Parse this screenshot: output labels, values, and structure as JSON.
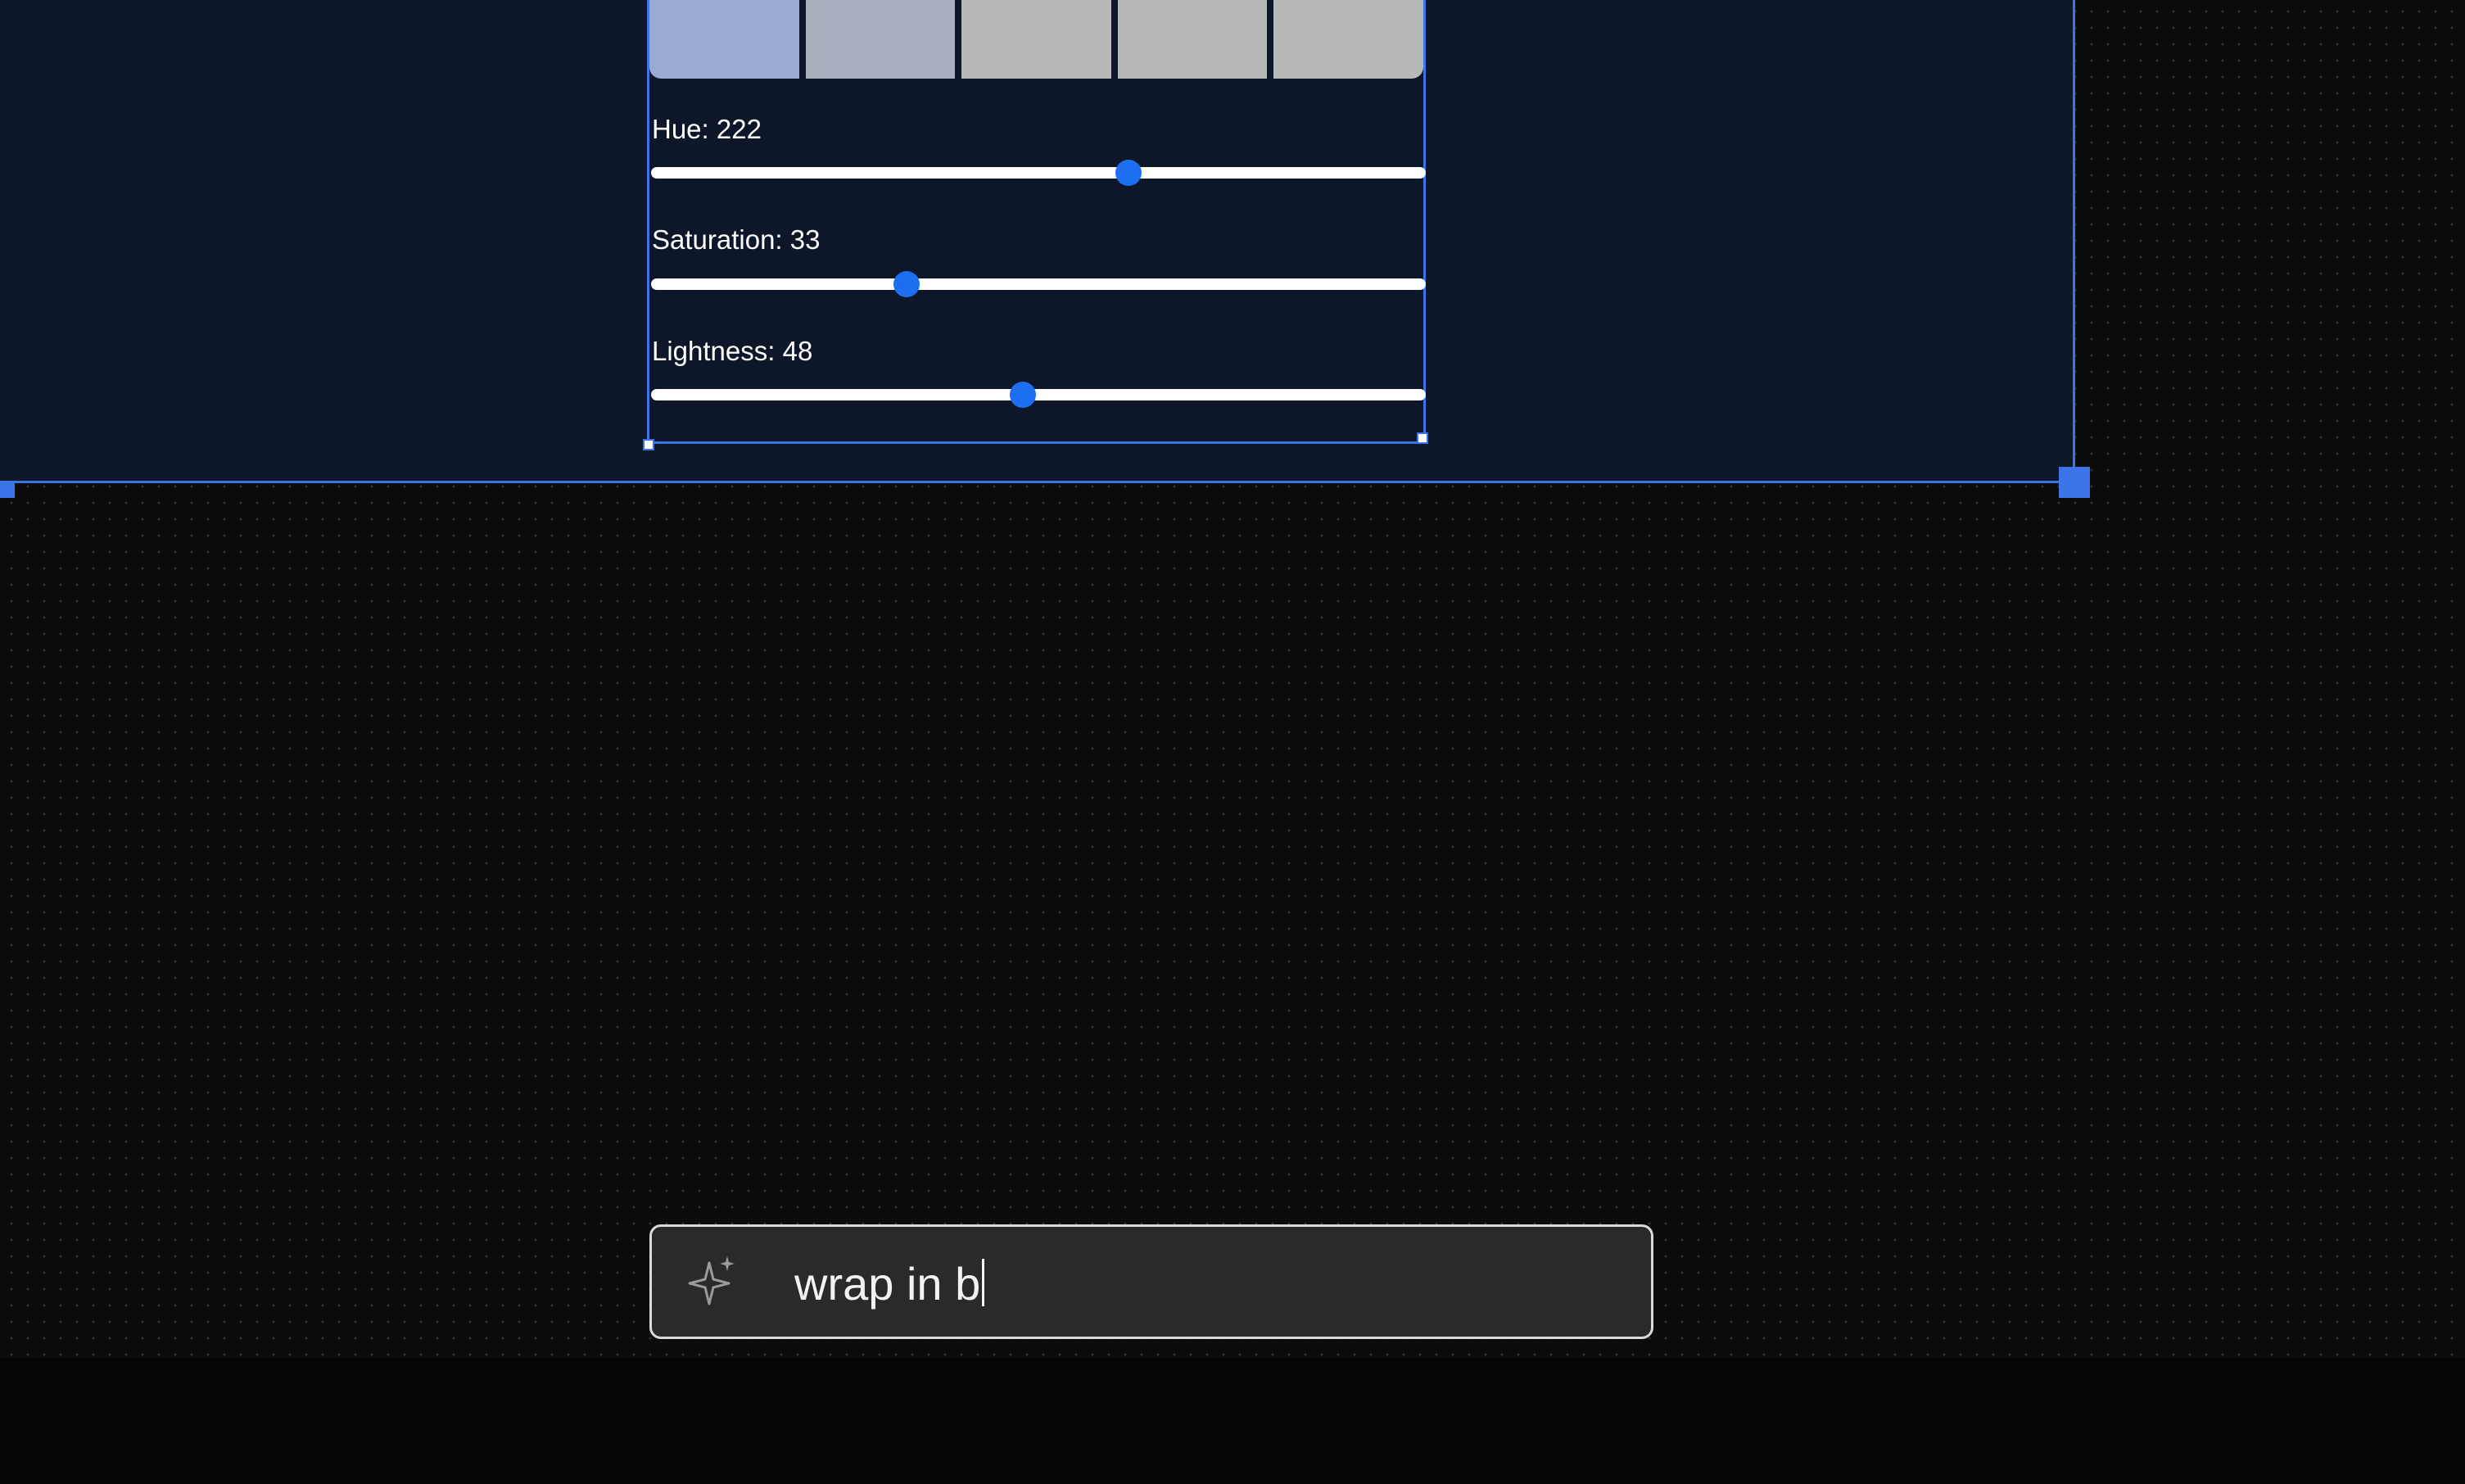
{
  "swatches": [
    {
      "color": "#9aaad0"
    },
    {
      "color": "#a9b0bd"
    },
    {
      "color": "#b8b8b8"
    },
    {
      "color": "#b8b8b8"
    },
    {
      "color": "#b8b8b8"
    }
  ],
  "sliders": {
    "hue": {
      "label": "Hue: 222",
      "value": 222,
      "min": 0,
      "max": 360
    },
    "saturation": {
      "label": "Saturation: 33",
      "value": 33,
      "min": 0,
      "max": 100
    },
    "lightness": {
      "label": "Lightness: 48",
      "value": 48,
      "min": 0,
      "max": 100
    }
  },
  "prompt": {
    "value": "wrap in b",
    "icon": "sparkle-icon"
  },
  "colors": {
    "accent": "#3b74e6",
    "thumb": "#1d6ff2",
    "frame_bg": "#0d1729",
    "canvas_bg": "#0b0b0c"
  }
}
